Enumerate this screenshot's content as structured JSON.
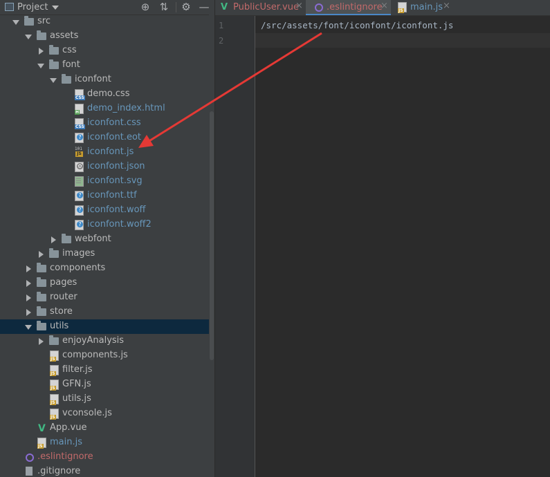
{
  "project_panel": {
    "title": "Project",
    "toolbar": [
      {
        "name": "locate-icon",
        "glyph": "⊕"
      },
      {
        "name": "collapse-all-icon",
        "glyph": "⇅"
      },
      {
        "name": "gear-icon",
        "glyph": "⚙"
      },
      {
        "name": "minimize-icon",
        "glyph": "—"
      }
    ],
    "tree": [
      {
        "label": "src",
        "type": "folder",
        "open": true,
        "indent": 0,
        "color": "#bbbbbb"
      },
      {
        "label": "assets",
        "type": "folder",
        "open": true,
        "indent": 1,
        "color": "#bbbbbb"
      },
      {
        "label": "css",
        "type": "folder",
        "open": false,
        "indent": 2,
        "color": "#bbbbbb"
      },
      {
        "label": "font",
        "type": "folder",
        "open": true,
        "indent": 2,
        "color": "#bbbbbb"
      },
      {
        "label": "iconfont",
        "type": "folder",
        "open": true,
        "indent": 3,
        "color": "#bbbbbb"
      },
      {
        "label": "demo.css",
        "type": "file",
        "icon": "css",
        "indent": 4,
        "color": "#bbbbbb"
      },
      {
        "label": "demo_index.html",
        "type": "file",
        "icon": "html",
        "indent": 4,
        "color": "#6897bb"
      },
      {
        "label": "iconfont.css",
        "type": "file",
        "icon": "css",
        "indent": 4,
        "color": "#6897bb"
      },
      {
        "label": "iconfont.eot",
        "type": "file",
        "icon": "unknown",
        "indent": 4,
        "color": "#6897bb"
      },
      {
        "label": "iconfont.js",
        "type": "file",
        "icon": "js-101",
        "indent": 4,
        "color": "#6897bb"
      },
      {
        "label": "iconfont.json",
        "type": "file",
        "icon": "json",
        "indent": 4,
        "color": "#6897bb"
      },
      {
        "label": "iconfont.svg",
        "type": "file",
        "icon": "svg",
        "indent": 4,
        "color": "#6897bb"
      },
      {
        "label": "iconfont.ttf",
        "type": "file",
        "icon": "unknown",
        "indent": 4,
        "color": "#6897bb"
      },
      {
        "label": "iconfont.woff",
        "type": "file",
        "icon": "unknown",
        "indent": 4,
        "color": "#6897bb"
      },
      {
        "label": "iconfont.woff2",
        "type": "file",
        "icon": "unknown",
        "indent": 4,
        "color": "#6897bb"
      },
      {
        "label": "webfont",
        "type": "folder",
        "open": false,
        "indent": 3,
        "color": "#bbbbbb"
      },
      {
        "label": "images",
        "type": "folder",
        "open": false,
        "indent": 2,
        "color": "#bbbbbb"
      },
      {
        "label": "components",
        "type": "folder",
        "open": false,
        "indent": 1,
        "color": "#bbbbbb"
      },
      {
        "label": "pages",
        "type": "folder",
        "open": false,
        "indent": 1,
        "color": "#bbbbbb"
      },
      {
        "label": "router",
        "type": "folder",
        "open": false,
        "indent": 1,
        "color": "#bbbbbb"
      },
      {
        "label": "store",
        "type": "folder",
        "open": false,
        "indent": 1,
        "color": "#bbbbbb"
      },
      {
        "label": "utils",
        "type": "folder",
        "open": true,
        "indent": 1,
        "color": "#bbbbbb",
        "selected": true
      },
      {
        "label": "enjoyAnalysis",
        "type": "folder",
        "open": false,
        "indent": 2,
        "color": "#bbbbbb"
      },
      {
        "label": "components.js",
        "type": "file",
        "icon": "js",
        "indent": 2,
        "color": "#bbbbbb"
      },
      {
        "label": "filter.js",
        "type": "file",
        "icon": "js",
        "indent": 2,
        "color": "#bbbbbb"
      },
      {
        "label": "GFN.js",
        "type": "file",
        "icon": "js",
        "indent": 2,
        "color": "#bbbbbb"
      },
      {
        "label": "utils.js",
        "type": "file",
        "icon": "js",
        "indent": 2,
        "color": "#bbbbbb"
      },
      {
        "label": "vconsole.js",
        "type": "file",
        "icon": "js",
        "indent": 2,
        "color": "#bbbbbb"
      },
      {
        "label": "App.vue",
        "type": "file",
        "icon": "vue",
        "indent": 1,
        "color": "#bbbbbb"
      },
      {
        "label": "main.js",
        "type": "file",
        "icon": "js",
        "indent": 1,
        "color": "#6897bb"
      },
      {
        "label": ".eslintignore",
        "type": "file",
        "icon": "ring",
        "indent": 0,
        "color": "#c26a6a"
      },
      {
        "label": ".gitignore",
        "type": "file",
        "icon": "git",
        "indent": 0,
        "color": "#bbbbbb"
      }
    ]
  },
  "tabs": [
    {
      "label": "PublicUser.vue",
      "icon": "vue",
      "color": "#c26a6a",
      "active": false,
      "close": "×"
    },
    {
      "label": ".eslintignore",
      "icon": "ring",
      "color": "#c26a6a",
      "active": true,
      "close": "×"
    },
    {
      "label": "main.js",
      "icon": "js",
      "color": "#6897bb",
      "active": false,
      "close": "×"
    }
  ],
  "editor": {
    "line_numbers": [
      "1",
      "2"
    ],
    "lines": [
      "/src/assets/font/iconfont/iconfont.js",
      ""
    ]
  },
  "colors": {
    "annotation_arrow": "#e53935",
    "accent": "#4a88c7"
  }
}
